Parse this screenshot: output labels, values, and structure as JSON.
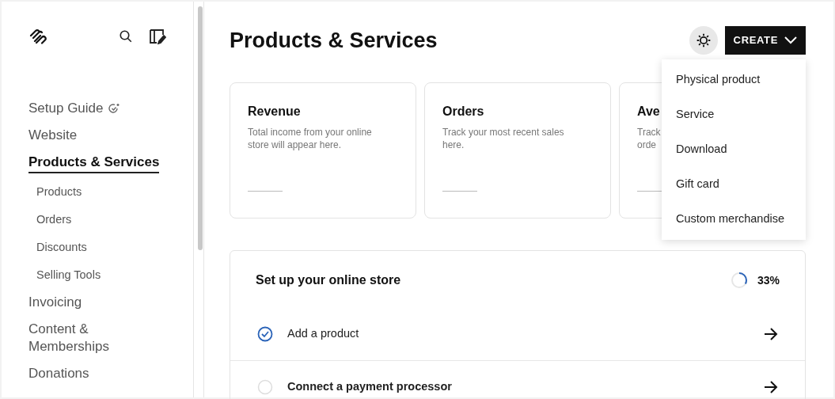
{
  "sidebar": {
    "items": [
      {
        "label": "Setup Guide",
        "selected": false,
        "badge_icon": true
      },
      {
        "label": "Website",
        "selected": false
      },
      {
        "label": "Products & Services",
        "selected": true,
        "children": [
          {
            "label": "Products",
            "selected": false
          },
          {
            "label": "Orders",
            "selected": false
          },
          {
            "label": "Discounts",
            "selected": false
          },
          {
            "label": "Selling Tools",
            "selected": false
          }
        ]
      },
      {
        "label": "Invoicing",
        "selected": false
      },
      {
        "label": "Content & Memberships",
        "selected": false
      },
      {
        "label": "Donations",
        "selected": false
      }
    ]
  },
  "header": {
    "title": "Products & Services",
    "create_button": "CREATE"
  },
  "create_menu": {
    "expanded": true,
    "items": [
      "Physical product",
      "Service",
      "Download",
      "Gift card",
      "Custom merchandise"
    ]
  },
  "cards": [
    {
      "title": "Revenue",
      "description": [
        "Total income from your online",
        "store will appear here."
      ]
    },
    {
      "title": "Orders",
      "description": [
        "Track your most recent sales",
        "here."
      ]
    },
    {
      "title": "Ave",
      "description": [
        "Track",
        "orde"
      ]
    }
  ],
  "setup": {
    "title": "Set up your online store",
    "progress": {
      "level": 0.33,
      "reading": "33%"
    },
    "tasks": [
      {
        "label": "Add a product",
        "checked": true
      },
      {
        "label": "Connect a payment processor",
        "checked": false
      }
    ]
  }
}
